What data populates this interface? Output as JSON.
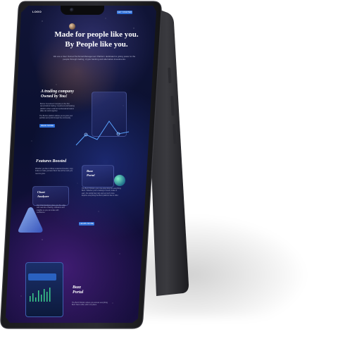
{
  "brand": "LOGO",
  "header_button": "GET STARTED",
  "hero": {
    "title_line1": "Made for people like you.",
    "title_line2": "By People like you.",
    "subtitle": "We are a User Owned Technical Management Platform dedicated to giving power to the people through trading, crypto banking and alternative investments."
  },
  "trading": {
    "title_line1": "A trading company",
    "title_line2": "Owned by You!",
    "body1": "Buzzer Investment Company is the first decentralized trading, investment and banking platform where retail and professional traders alike can work together.",
    "body2": "The Buzzer platform allows you to grow your portfolio and profit through the community.",
    "button": "READ MORE"
  },
  "features": {
    "title": "Features Boosted",
    "body": "Whether you like to follow a talented investor, copy trades or trade yourself, Buzz has all the tools you need to grow."
  },
  "buzz_portal_card": {
    "title_line1": "Buzz",
    "title_line2": "Portal",
    "body": "The Buzz Portal is your one-stop shop for everything Buzz. Whether you're looking to invest, trade or earn, the portal has it all, and so much more. Explore everything the Buzz platform has to offer.",
    "button": "LEARN MORE"
  },
  "chart_card": {
    "title_line1": "Chart",
    "title_line2": "Analyzer",
    "body": "Our Chart Analyzer gives you the edge with real-time charting, indicators and insights so you can trade with confidence."
  },
  "bottom": {
    "title_line1": "Buzz",
    "title_line2": "Portal",
    "body": "The Buzz Portal is where you access everything Buzz has to offer, all in one place."
  },
  "colors": {
    "accent": "#2f6fd8",
    "screen_bg": "#0b1030",
    "phone_frame": "#1b1b1f",
    "line_chart": "#5aa3ff"
  },
  "icons": [
    "camera-icon",
    "planet-icon",
    "line-chart-graphic",
    "triangle-shape-icon",
    "orb-icon"
  ]
}
